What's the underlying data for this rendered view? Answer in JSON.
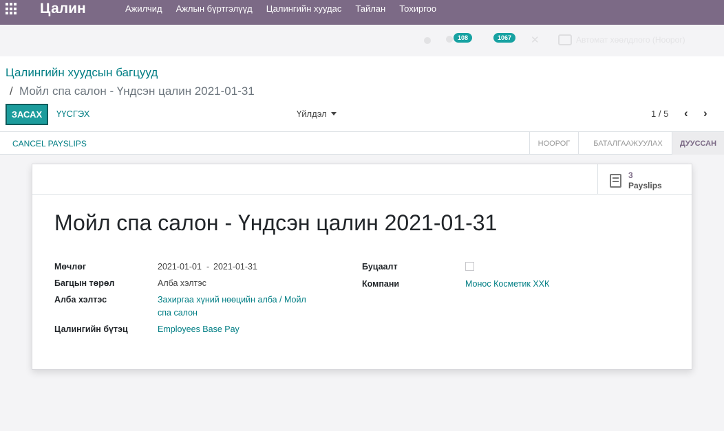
{
  "navbar": {
    "brand": "Цалин",
    "menu": [
      "Ажилчид",
      "Ажлын бүртгэлүүд",
      "Цалингийн хуудас",
      "Тайлан",
      "Тохиргоо"
    ]
  },
  "systray": {
    "messages_count": "108",
    "activities_count": "1067",
    "pos_text": "Автомат хөөлдлого (Ноорог)"
  },
  "breadcrumb": {
    "parent": "Цалингийн хуудсын багцууд",
    "separator": "/",
    "current": "Мойл спа салон - Үндсэн цалин 2021-01-31"
  },
  "buttons": {
    "edit": "ЗАСАХ",
    "create": "ҮҮСГЭХ",
    "action": "Үйлдэл",
    "cancel_payslips": "CANCEL PAYSLIPS"
  },
  "pager": {
    "value": "1 / 5"
  },
  "status": {
    "stages": [
      "НООРОГ",
      "БАТАЛГААЖУУЛАХ",
      "ДУУССАН"
    ],
    "active": "ДУУССАН"
  },
  "stat": {
    "value": "3",
    "label": "Payslips"
  },
  "form": {
    "title": "Мойл спа салон - Үндсэн цалин 2021-01-31",
    "fields": {
      "period_label": "Мөчлөг",
      "period_start": "2021-01-01",
      "period_sep": "-",
      "period_end": "2021-01-31",
      "batch_type_label": "Багцын төрөл",
      "batch_type_value": "Алба хэлтэс",
      "department_label": "Алба хэлтэс",
      "department_value_line1": "Захиргаа хүний нөөцийн алба / Мойл",
      "department_value_line2": "спа салон",
      "structure_label": "Цалингийн бүтэц",
      "structure_value": "Employees Base Pay",
      "refund_label": "Буцаалт",
      "company_label": "Компани",
      "company_value": "Монос Косметик ХХК"
    }
  }
}
